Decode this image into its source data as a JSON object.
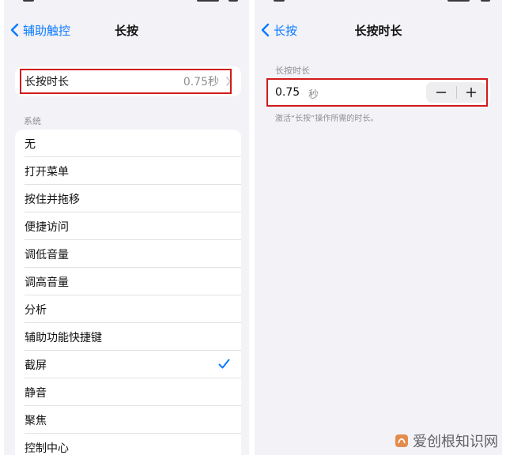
{
  "left": {
    "nav": {
      "back_label": "辅助触控",
      "title": "长按"
    },
    "duration_row": {
      "label": "长按时长",
      "value": "0.75秒"
    },
    "section_header": "系统",
    "options": [
      {
        "label": "无",
        "checked": false
      },
      {
        "label": "打开菜单",
        "checked": false
      },
      {
        "label": "按住并拖移",
        "checked": false
      },
      {
        "label": "便捷访问",
        "checked": false
      },
      {
        "label": "调低音量",
        "checked": false
      },
      {
        "label": "调高音量",
        "checked": false
      },
      {
        "label": "分析",
        "checked": false
      },
      {
        "label": "辅助功能快捷键",
        "checked": false
      },
      {
        "label": "截屏",
        "checked": true
      },
      {
        "label": "静音",
        "checked": false
      },
      {
        "label": "聚焦",
        "checked": false
      },
      {
        "label": "控制中心",
        "checked": false
      }
    ]
  },
  "right": {
    "nav": {
      "back_label": "长按",
      "title": "长按时长"
    },
    "group_label": "长按时长",
    "input_value": "0.75",
    "unit": "秒",
    "footnote": "激活“长按”操作所需的时长。"
  },
  "watermark": {
    "text": "爱创根知识网"
  },
  "colors": {
    "accent": "#0a7aff",
    "highlight_box": "#d21b1b",
    "background": "#f2f2f7"
  }
}
